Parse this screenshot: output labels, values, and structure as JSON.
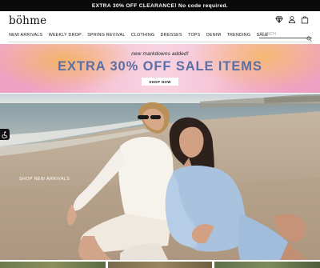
{
  "promo": {
    "text": "EXTRA 30% OFF CLEARANCE! No code required."
  },
  "header": {
    "logo": "böhme",
    "search_placeholder": "SEARCH",
    "icons": [
      "diamond-icon",
      "account-icon",
      "bag-icon",
      "search-icon"
    ]
  },
  "nav": {
    "items": [
      {
        "label": "NEW ARRIVALS"
      },
      {
        "label": "WEEKLY DROP"
      },
      {
        "label": "SPRING REVIVAL"
      },
      {
        "label": "CLOTHING"
      },
      {
        "label": "DRESSES"
      },
      {
        "label": "TOPS"
      },
      {
        "label": "DENIM"
      },
      {
        "label": "TRENDING"
      },
      {
        "label": "SALE"
      }
    ]
  },
  "banner": {
    "kicker": "new markdowns added!",
    "headline": "EXTRA 30% OFF SALE ITEMS",
    "cta": "SHOP NOW",
    "colors": {
      "headline": "#5b6ea6",
      "background_pink": "#f6c4d6",
      "background_orange": "#f3b36a"
    }
  },
  "hero": {
    "cta": "SHOP NEW ARRIVALS"
  },
  "accessibility": {
    "icon": "accessibility-icon"
  }
}
